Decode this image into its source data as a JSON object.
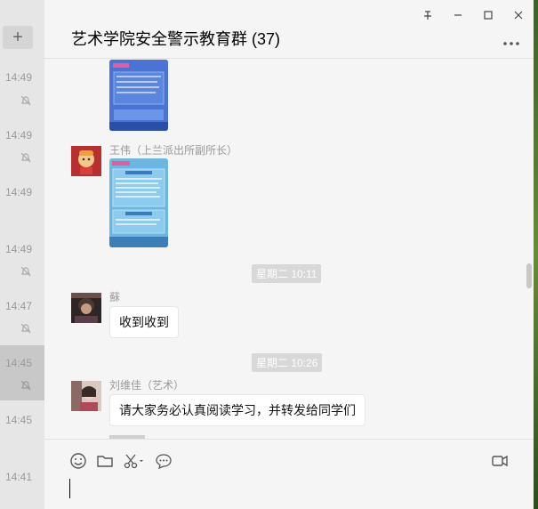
{
  "window": {
    "title": "艺术学院安全警示教育群 (37)"
  },
  "left_list": {
    "add_label": "+",
    "times": [
      "14:49",
      "14:49",
      "14:49",
      "14:49",
      "14:47",
      "14:45",
      "14:45",
      "14:41"
    ]
  },
  "messages": [
    {
      "sender": "王伟（上兰派出所副所长）"
    },
    {
      "timestamp": "星期二 10:11"
    },
    {
      "sender": "蘇",
      "text": "收到收到"
    },
    {
      "timestamp": "星期二 10:26"
    },
    {
      "sender": "刘维佳（艺术）",
      "text": "请大家务必认真阅读学习，并转发给同学们"
    }
  ],
  "input": {
    "value": ""
  }
}
